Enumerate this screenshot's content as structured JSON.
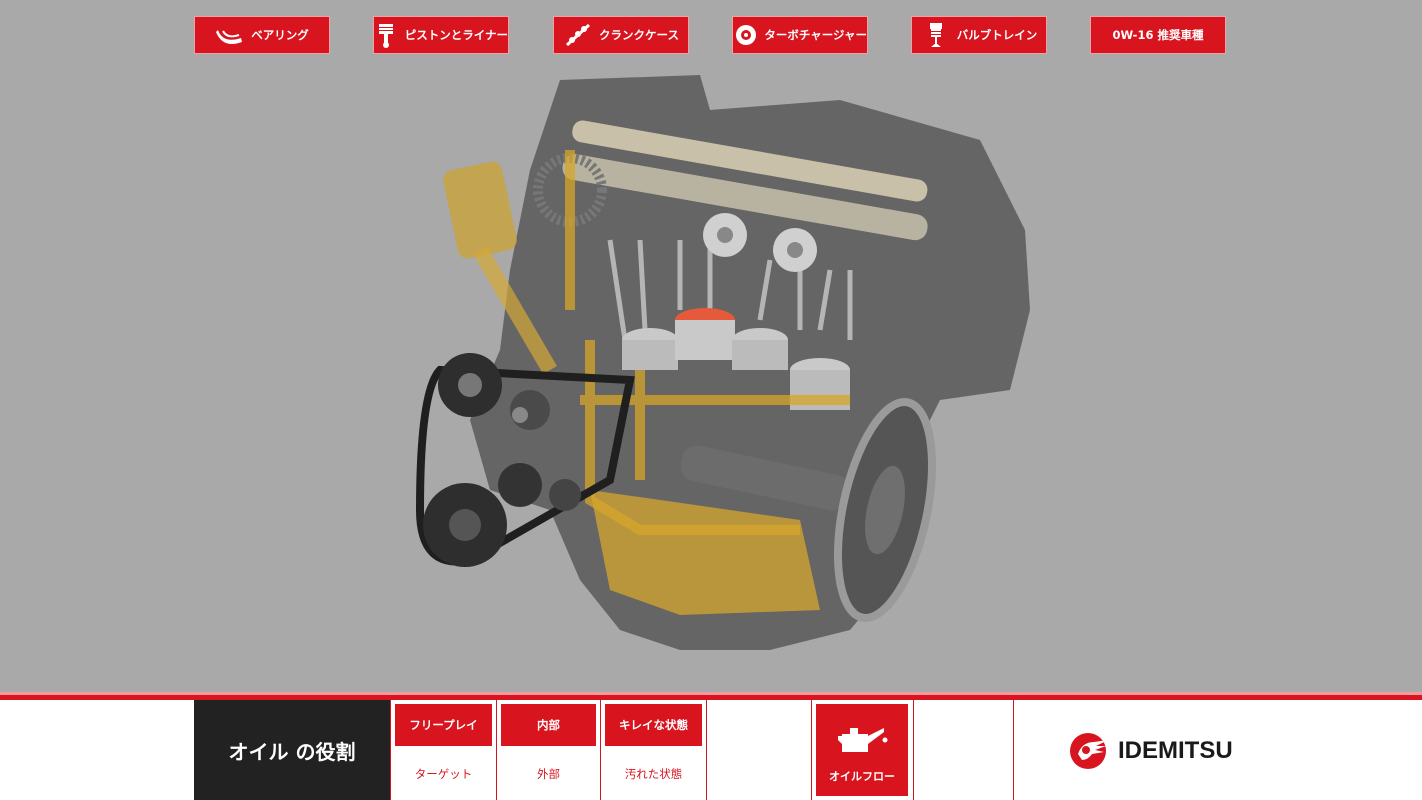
{
  "topnav": [
    {
      "label": "ベアリング",
      "icon": "bearing-icon"
    },
    {
      "label": "ピストンとライナー",
      "icon": "piston-icon"
    },
    {
      "label": "クランクケース",
      "icon": "crankcase-icon"
    },
    {
      "label": "ターボチャージャー",
      "icon": "turbo-icon"
    },
    {
      "label": "バルブトレイン",
      "icon": "valve-icon"
    },
    {
      "label": "0W-16 推奨車種",
      "icon": ""
    }
  ],
  "bottom": {
    "role_title": "オイル の役割",
    "tabs": [
      {
        "label": "フリープレイ",
        "sub": "ターゲット"
      },
      {
        "label": "内部",
        "sub": "外部"
      },
      {
        "label": "キレイな状態",
        "sub": "汚れた状態"
      }
    ],
    "oil_flow": "オイルフロー",
    "brand": "IDEMITSU"
  },
  "colors": {
    "accent": "#d8141f",
    "background": "#a9a9a9",
    "dark": "#222222"
  }
}
